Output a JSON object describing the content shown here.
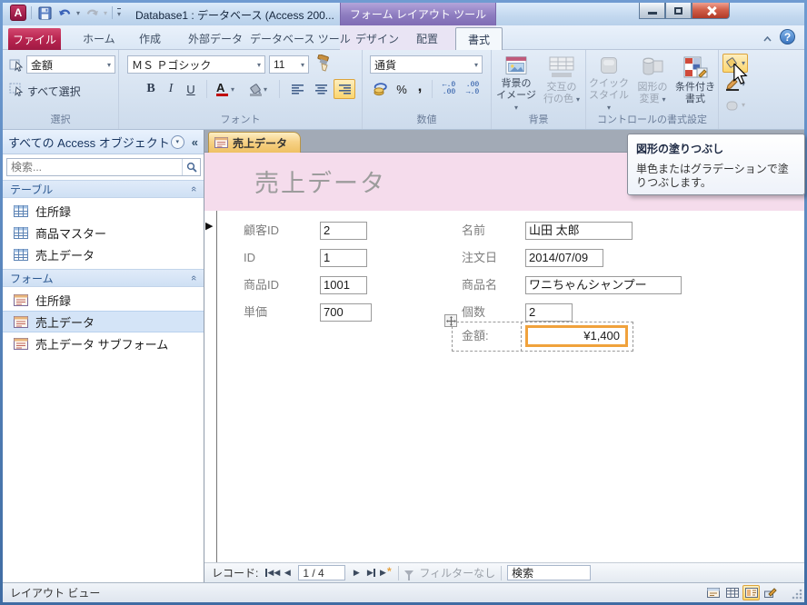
{
  "window": {
    "title": "Database1 : データベース (Access 200...",
    "context_title": "フォーム レイアウト ツール",
    "status_text": "レイアウト ビュー"
  },
  "tabs": {
    "file": "ファイル",
    "home": "ホーム",
    "create": "作成",
    "external_data": "外部データ",
    "db_tools": "データベース ツール",
    "design": "デザイン",
    "arrange": "配置",
    "format": "書式"
  },
  "ribbon": {
    "selection": {
      "label": "選択",
      "object_name": "金額",
      "select_all": "すべて選択"
    },
    "font": {
      "label": "フォント",
      "name": "ＭＳ Ｐゴシック",
      "size": "11"
    },
    "number": {
      "label": "数値",
      "format": "通貨",
      "inc_top": "←.0",
      "inc_bottom": ".00",
      "dec_top": ".00",
      "dec_bottom": "→.0"
    },
    "background": {
      "label": "背景",
      "bg_image_l1": "背景の",
      "bg_image_l2": "イメージ",
      "alt_row_l1": "交互の",
      "alt_row_l2": "行の色"
    },
    "control_format": {
      "label": "コントロールの書式設定",
      "quick_l1": "クイック",
      "quick_l2": "スタイル",
      "shape_l1": "図形の",
      "shape_l2": "変更",
      "cond_l1": "条件付き",
      "cond_l2": "書式"
    }
  },
  "tooltip": {
    "title": "図形の塗りつぶし",
    "body": "単色またはグラデーションで塗りつぶします。"
  },
  "sidebar": {
    "title": "すべての Access オブジェクト",
    "search_placeholder": "検索...",
    "sections": [
      {
        "label": "テーブル",
        "items": [
          {
            "name": "住所録"
          },
          {
            "name": "商品マスター"
          },
          {
            "name": "売上データ"
          }
        ]
      },
      {
        "label": "フォーム",
        "items": [
          {
            "name": "住所録"
          },
          {
            "name": "売上データ"
          },
          {
            "name": "売上データ サブフォーム"
          }
        ]
      }
    ]
  },
  "document": {
    "tab_title": "売上データ",
    "form_title": "売上データ",
    "left_fields": [
      {
        "label": "顧客ID",
        "value": "2"
      },
      {
        "label": "ID",
        "value": "1"
      },
      {
        "label": "商品ID",
        "value": "1001"
      },
      {
        "label": "単価",
        "value": "700"
      }
    ],
    "right_fields": [
      {
        "label": "名前",
        "value": "山田 太郎"
      },
      {
        "label": "注文日",
        "value": "2014/07/09"
      },
      {
        "label": "商品名",
        "value": "ワニちゃんシャンプー"
      },
      {
        "label": "個数",
        "value": "2"
      },
      {
        "label": "金額:",
        "value": "¥1,400"
      }
    ]
  },
  "record_nav": {
    "label": "レコード:",
    "position": "1 / 4",
    "filter_label": "フィルターなし",
    "search_value": "検索"
  },
  "icons": {
    "dropdown": "▾",
    "collapse_pane": "«",
    "section_chevron": "«",
    "prev_triangle": "◀",
    "next_triangle": "▶",
    "record_arrow": "▶",
    "new_star": "*",
    "percent": "%",
    "comma": ",",
    "bold": "B",
    "italic": "I",
    "underline": "U",
    "font_color_letter": "A",
    "help": "?",
    "logo_letter": "A"
  },
  "colors": {
    "accent_orange": "#f0a23c",
    "file_tab_red": "#b92450",
    "context_purple": "#8d7cc0",
    "header_pink": "#f5dcec"
  }
}
